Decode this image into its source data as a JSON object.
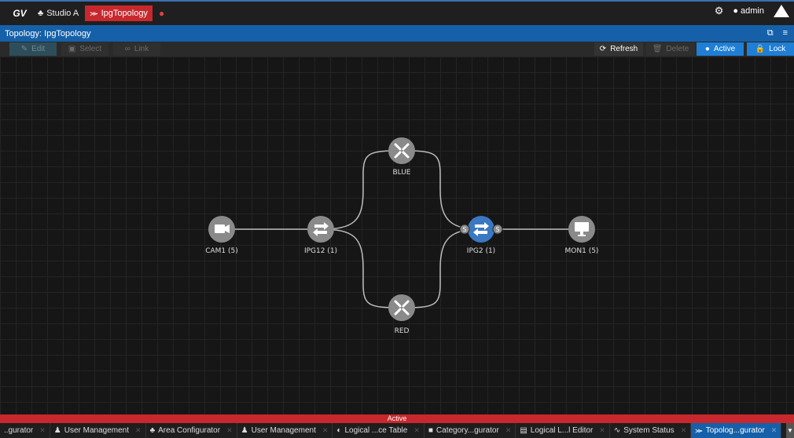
{
  "topbar": {
    "logo": "GV",
    "studio": "Studio A",
    "active_tab": "IpgTopology",
    "user": "admin"
  },
  "titlebar": {
    "title": "Topology: IpgTopology"
  },
  "toolbar": {
    "edit": "Edit",
    "select": "Select",
    "link": "Link",
    "refresh": "Refresh",
    "delete": "Delete",
    "active": "Active",
    "lock": "Lock"
  },
  "nodes": {
    "cam1": "CAM1 (5)",
    "ipg12": "IPG12 (1)",
    "blue": "BLUE",
    "red": "RED",
    "ipg2": "IPG2 (1)",
    "mon1": "MON1 (5)"
  },
  "status": "Active",
  "bottom_tabs": [
    {
      "label": "..gurator",
      "icon": ""
    },
    {
      "label": "User Management",
      "icon": "users-icon"
    },
    {
      "label": "Area Configurator",
      "icon": "area-icon"
    },
    {
      "label": "User Management",
      "icon": "users-icon"
    },
    {
      "label": "Logical ...ce Table",
      "icon": "logical-icon"
    },
    {
      "label": "Category...gurator",
      "icon": "category-icon"
    },
    {
      "label": "Logical L...l Editor",
      "icon": "editor-icon"
    },
    {
      "label": "System Status",
      "icon": "pulse-icon"
    },
    {
      "label": "Topolog...gurator",
      "icon": "topology-icon"
    }
  ],
  "colors": {
    "accent_blue": "#1560a8",
    "accent_red": "#c8282d",
    "node_gray": "#8a8a8a",
    "node_selected": "#3a78c2"
  }
}
